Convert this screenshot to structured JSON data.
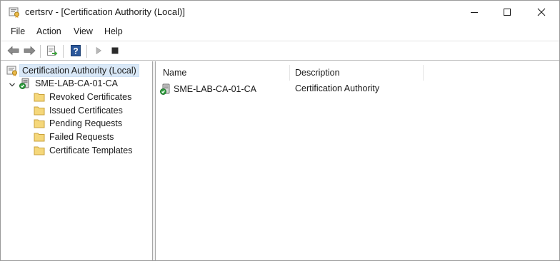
{
  "window": {
    "title": "certsrv - [Certification Authority (Local)]",
    "icon": "certsrv-app-icon",
    "controls": [
      "minimize-icon",
      "maximize-icon",
      "close-icon"
    ]
  },
  "menu": {
    "file": "File",
    "action": "Action",
    "view": "View",
    "help": "Help"
  },
  "toolbar": {
    "icons": [
      "back-arrow-icon",
      "forward-arrow-icon",
      "export-list-icon",
      "help-icon",
      "start-service-icon",
      "stop-service-icon"
    ]
  },
  "tree": {
    "root": {
      "label": "Certification Authority (Local)",
      "icon": "certification-authority-icon",
      "selected": true
    },
    "ca": {
      "label": "SME-LAB-CA-01-CA",
      "icon": "ca-server-icon",
      "expanded": true
    },
    "folders": [
      {
        "label": "Revoked Certificates",
        "icon": "folder-icon"
      },
      {
        "label": "Issued Certificates",
        "icon": "folder-icon"
      },
      {
        "label": "Pending Requests",
        "icon": "folder-icon"
      },
      {
        "label": "Failed Requests",
        "icon": "folder-icon"
      },
      {
        "label": "Certificate Templates",
        "icon": "folder-icon"
      }
    ]
  },
  "list": {
    "columns": [
      "Name",
      "Description"
    ],
    "rows": [
      {
        "name": "SME-LAB-CA-01-CA",
        "description": "Certification Authority",
        "icon": "ca-server-icon"
      }
    ]
  },
  "colors": {
    "selection": "#d9e8f7",
    "folder": "#f5d77a",
    "toolbar_arrow": "#6e6e6e",
    "help_blue": "#2b579a"
  }
}
